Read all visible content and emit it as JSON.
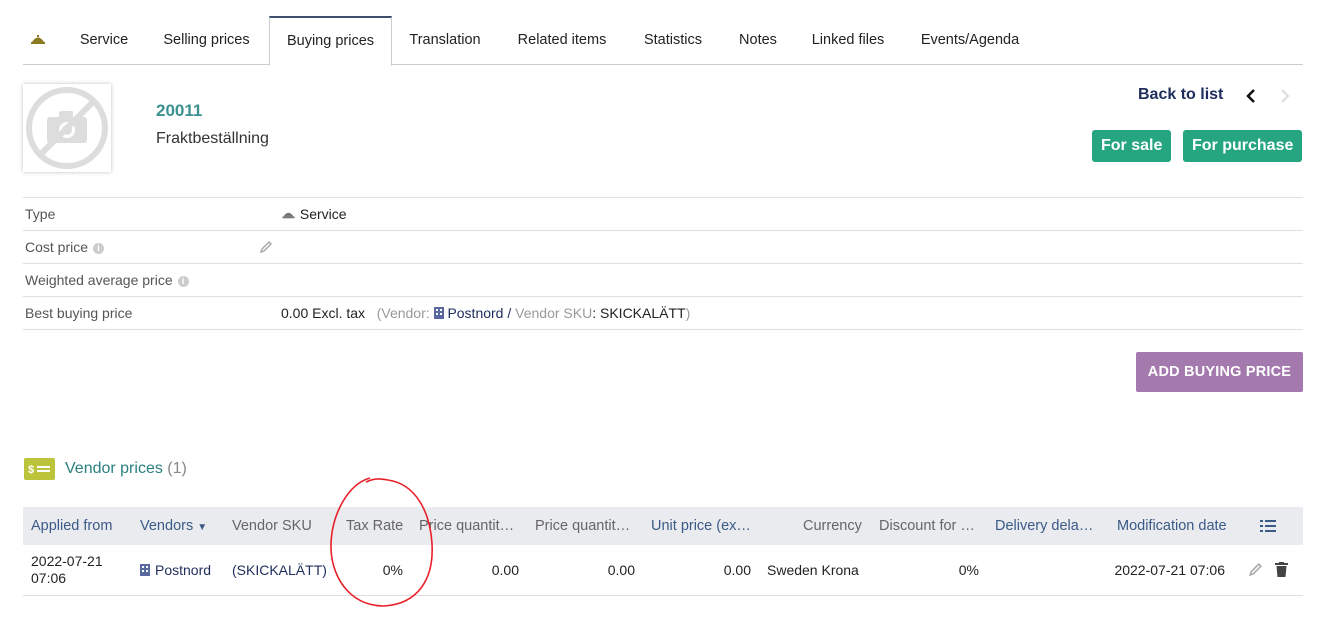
{
  "tabs": {
    "items": [
      {
        "label": "Service"
      },
      {
        "label": "Selling prices"
      },
      {
        "label": "Buying prices"
      },
      {
        "label": "Translation"
      },
      {
        "label": "Related items"
      },
      {
        "label": "Statistics"
      },
      {
        "label": "Notes"
      },
      {
        "label": "Linked files"
      },
      {
        "label": "Events/Agenda"
      }
    ],
    "active": "Buying prices"
  },
  "product": {
    "ref": "20011",
    "label": "Fraktbeställning",
    "back_label": "Back to list",
    "badge_sale": "For sale",
    "badge_purchase": "For purchase"
  },
  "fields": {
    "type_label": "Type",
    "type_value": "Service",
    "cost_label": "Cost price",
    "wap_label": "Weighted average price",
    "best_label": "Best buying price",
    "best_amount": "0.00 Excl. tax",
    "best_vendor_prefix": "(Vendor",
    "best_vendor": "Postnord",
    "best_sku_prefix": "Vendor SKU",
    "best_sku": "SKICKALÄTT",
    "best_close": ")"
  },
  "add_button": "ADD BUYING PRICE",
  "vendor_prices": {
    "title": "Vendor prices",
    "count": "(1)",
    "columns": {
      "applied_from": "Applied from",
      "vendors": "Vendors",
      "vendor_sku": "Vendor SKU",
      "tax_rate": "Tax Rate",
      "price_qty1": "Price quantit…",
      "price_qty2": "Price quantit…",
      "unit_price": "Unit price (ex…",
      "currency": "Currency",
      "discount": "Discount for …",
      "delivery": "Delivery dela…",
      "modification": "Modification date"
    },
    "rows": [
      {
        "applied_from_date": "2022-07-21",
        "applied_from_time": "07:06",
        "vendor": "Postnord",
        "sku": "(SKICKALÄTT)",
        "tax_rate": "0%",
        "price_qty1": "0.00",
        "price_qty2": "0.00",
        "unit_price": "0.00",
        "currency": "Sweden Krona",
        "discount": "0%",
        "delivery": "",
        "modification": "2022-07-21 07:06"
      }
    ]
  },
  "colors": {
    "accent_green": "#25a580",
    "accent_purple": "#a47aae",
    "teal_text": "#3b9090",
    "annotation_red": "#e8202a"
  }
}
